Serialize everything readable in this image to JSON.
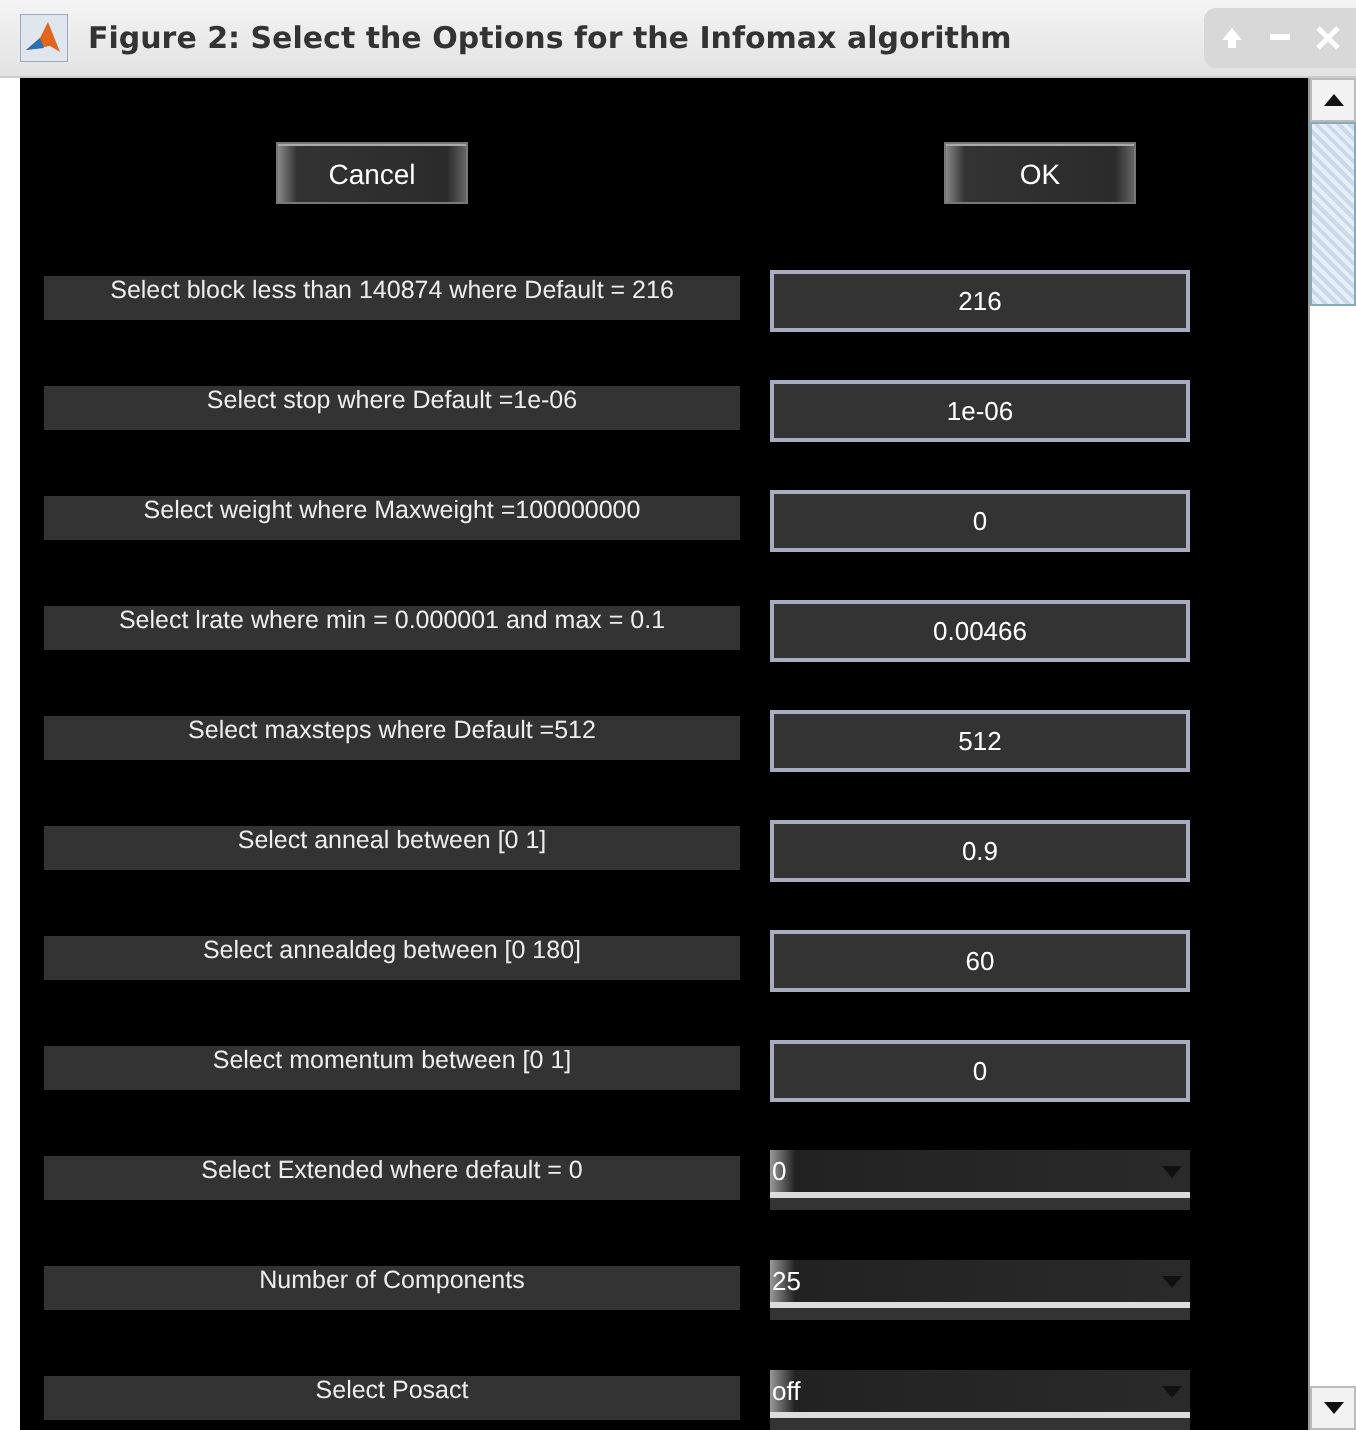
{
  "window": {
    "title": "Figure 2: Select the Options for the Infomax algorithm"
  },
  "buttons": [
    {
      "label": "Cancel"
    },
    {
      "label": "OK"
    }
  ],
  "options": [
    {
      "kind": "text",
      "label": "Select block less than 140874 where Default = 216",
      "value": "216"
    },
    {
      "kind": "text",
      "label": "Select stop where Default =1e-06",
      "value": "1e-06"
    },
    {
      "kind": "text",
      "label": "Select weight where Maxweight =100000000",
      "value": "0"
    },
    {
      "kind": "text",
      "label": "Select lrate where min = 0.000001 and max = 0.1",
      "value": "0.00466"
    },
    {
      "kind": "text",
      "label": "Select maxsteps where Default =512",
      "value": "512"
    },
    {
      "kind": "text",
      "label": "Select anneal between [0 1]",
      "value": "0.9"
    },
    {
      "kind": "text",
      "label": "Select annealdeg between [0 180]",
      "value": "60"
    },
    {
      "kind": "text",
      "label": "Select momentum between [0 1]",
      "value": "0"
    },
    {
      "kind": "dropdown",
      "label": "Select Extended where default = 0",
      "value": "0"
    },
    {
      "kind": "dropdown",
      "label": "Number of Components",
      "value": "25"
    },
    {
      "kind": "dropdown",
      "label": "Select Posact",
      "value": "off"
    }
  ]
}
